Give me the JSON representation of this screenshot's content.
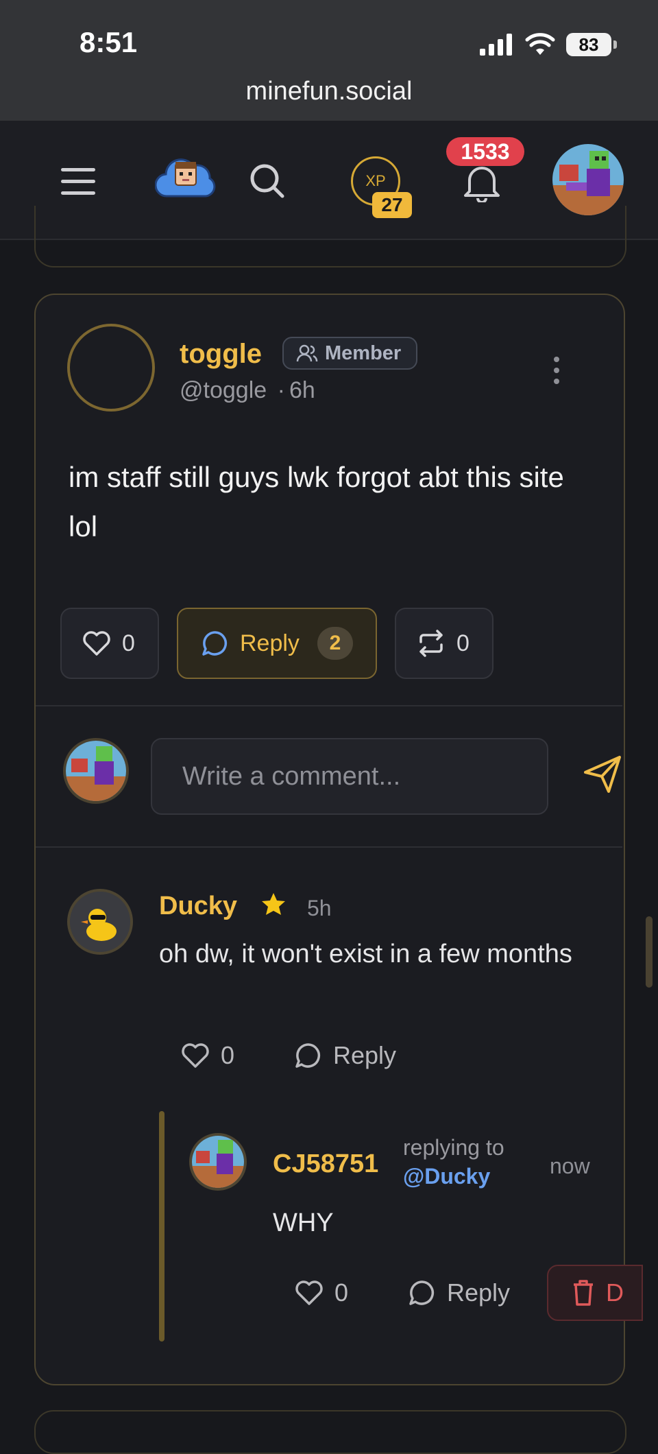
{
  "status_bar": {
    "time": "8:51",
    "battery": "83"
  },
  "browser": {
    "url": "minefun.social"
  },
  "header": {
    "xp_label": "XP",
    "xp_level": "27",
    "notification_count": "1533"
  },
  "post": {
    "author_name": "toggle",
    "role_badge": "Member",
    "handle": "@toggle",
    "separator": "·",
    "time": "6h",
    "body": "im staff still guys lwk forgot abt this site lol",
    "like_count": "0",
    "reply_label": "Reply",
    "reply_count": "2",
    "repost_count": "0"
  },
  "comment_box": {
    "placeholder": "Write a comment..."
  },
  "comments": [
    {
      "author": "Ducky",
      "time": "5h",
      "body": "oh dw, it won't exist in a few months",
      "like_count": "0",
      "reply_label": "Reply"
    }
  ],
  "reply": {
    "author": "CJ58751",
    "replying_to_label": "replying to",
    "replying_to_handle": "@Ducky",
    "time": "now",
    "body": "WHY",
    "like_count": "0",
    "reply_label": "Reply",
    "delete_label": "D"
  },
  "colors": {
    "accent_gold": "#f0bd4a",
    "mention_blue": "#6aa0ef",
    "notif_red": "#e1414c"
  }
}
